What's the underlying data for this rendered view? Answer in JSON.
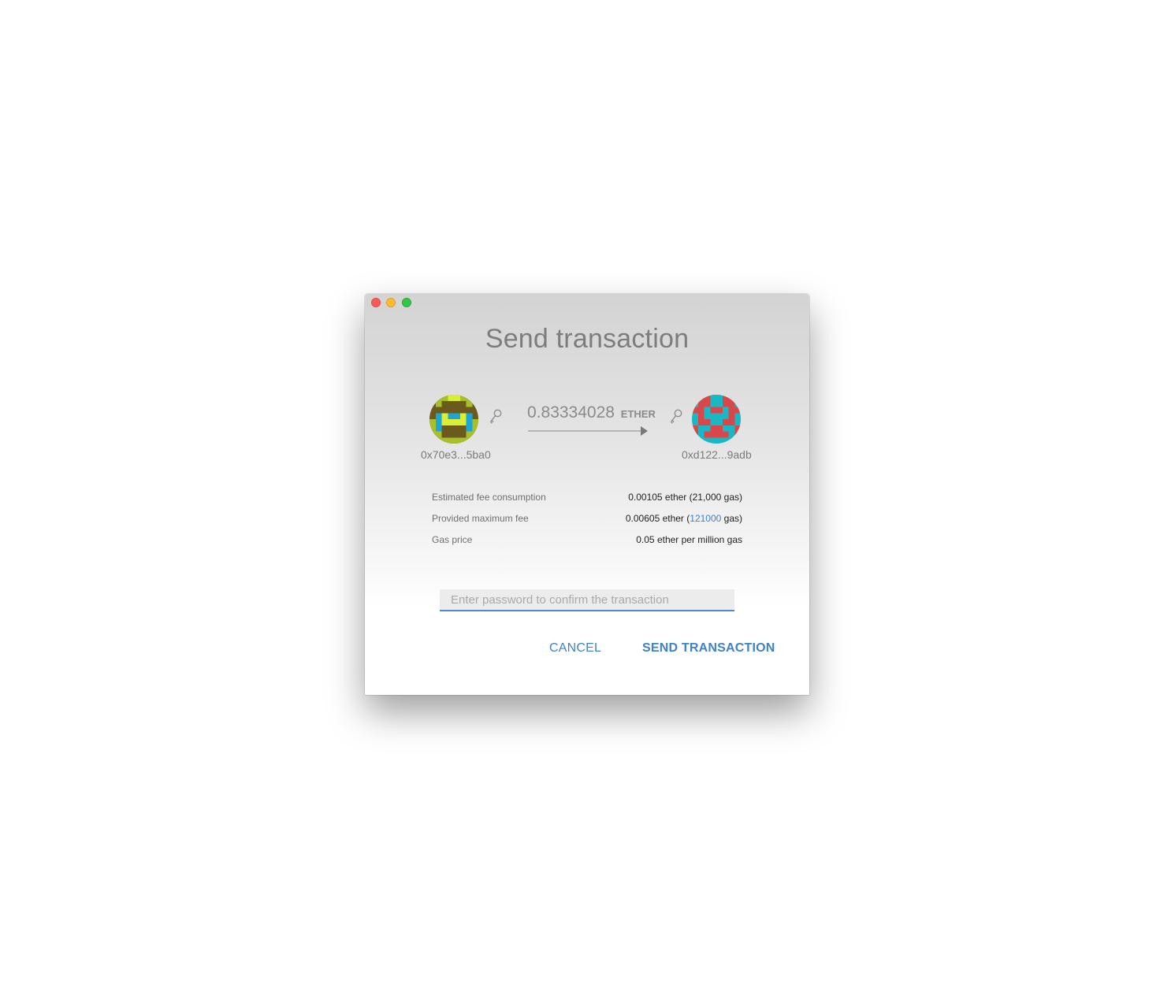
{
  "window": {
    "controls": [
      "close",
      "minimize",
      "maximize"
    ]
  },
  "title": "Send transaction",
  "from": {
    "address": "0x70e3...5ba0",
    "icon": "identicon",
    "key_icon": "key-icon"
  },
  "to": {
    "address": "0xd122...9adb",
    "icon": "identicon",
    "key_icon": "key-icon"
  },
  "amount": {
    "value": "0.83334028",
    "unit": "ETHER"
  },
  "fees": {
    "estimated_label": "Estimated fee consumption",
    "estimated_value": "0.00105 ether (21,000 gas)",
    "max_label": "Provided maximum fee",
    "max_value_prefix": "0.00605 ether (",
    "max_value_gas": "121000",
    "max_value_suffix": " gas)",
    "gas_price_label": "Gas price",
    "gas_price_value": "0.05 ether per million gas"
  },
  "password": {
    "value": "",
    "placeholder": "Enter password to confirm the transaction"
  },
  "buttons": {
    "cancel": "CANCEL",
    "send": "SEND TRANSACTION"
  },
  "colors": {
    "accent": "#3e82c8",
    "close": "#fc5b57",
    "minimize": "#fdbc2e",
    "maximize": "#33c748"
  }
}
